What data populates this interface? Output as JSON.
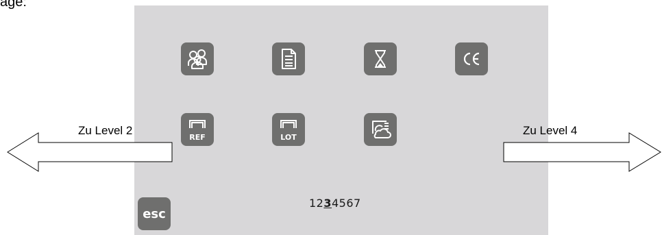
{
  "caption": "age:",
  "nav": {
    "left_label": "Zu Level 2",
    "right_label": "Zu Level 4"
  },
  "buttons": {
    "esc_label": "esc",
    "ref_label": "REF",
    "lot_label": "LOT",
    "ce_label": "CE"
  },
  "icons": {
    "row1": [
      "users-icon",
      "document-icon",
      "hourglass-icon",
      "ce-mark-icon"
    ],
    "row2": [
      "ref-icon",
      "lot-icon",
      "cloud-display-icon"
    ]
  },
  "pager": {
    "before": "12",
    "current": "3",
    "after": "4567"
  },
  "colors": {
    "panel": "#d8d7d9",
    "button": "#6f6f6e",
    "icon_fg": "#ffffff"
  }
}
